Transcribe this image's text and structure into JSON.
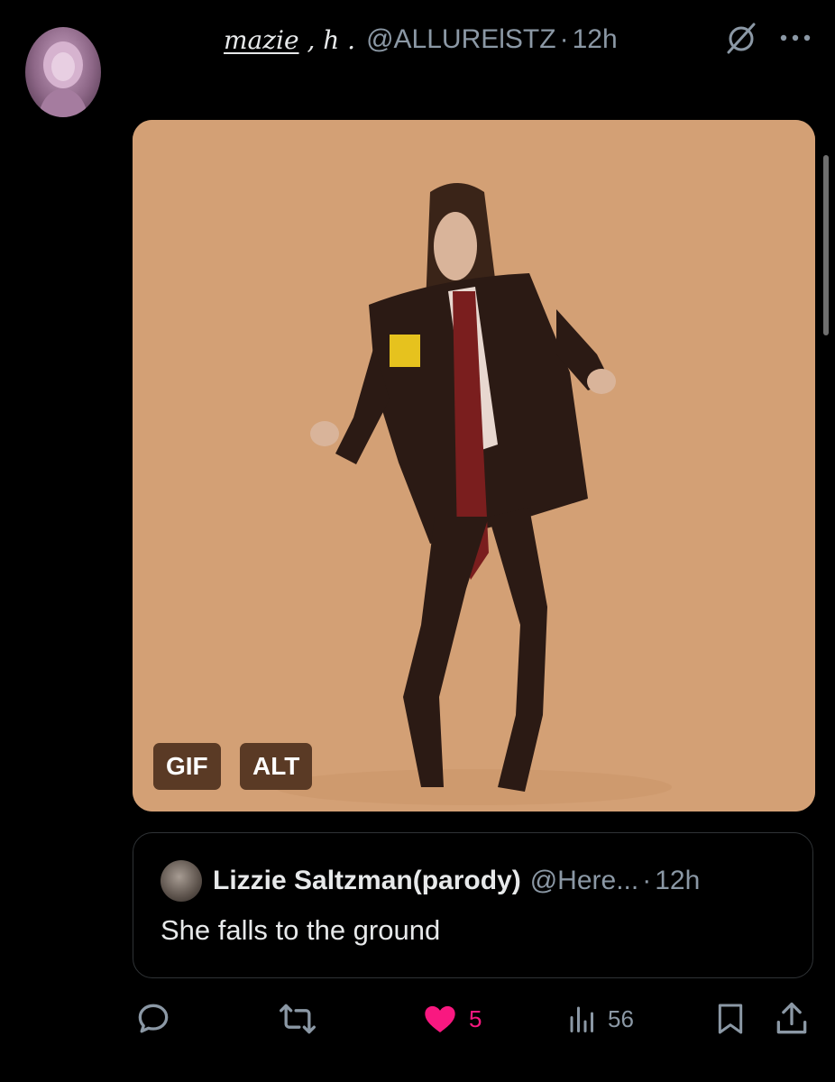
{
  "tweet": {
    "author": {
      "display_name_main": "mazie",
      "display_name_rest": ", h .",
      "handle": "@ALLURElSTZ",
      "separator": "·",
      "time": "12h"
    },
    "media": {
      "badges": [
        "GIF",
        "ALT"
      ]
    },
    "quote": {
      "name": "Lizzie Saltzman(parody)",
      "handle": "@Here...",
      "separator": "·",
      "time": "12h",
      "text": "She falls to the ground"
    },
    "actions": {
      "like_count": "5",
      "views_count": "56"
    },
    "icons": {
      "header": [
        "grok-icon",
        "more-icon"
      ],
      "actions": [
        "reply-icon",
        "retweet-icon",
        "like-icon",
        "views-icon",
        "bookmark-icon",
        "share-icon"
      ]
    },
    "colors": {
      "background": "#000000",
      "text": "#e7e9ea",
      "secondary_text": "#8b98a5",
      "like": "#f91880",
      "border": "#2f3336",
      "badge": "#5a3a25"
    }
  }
}
